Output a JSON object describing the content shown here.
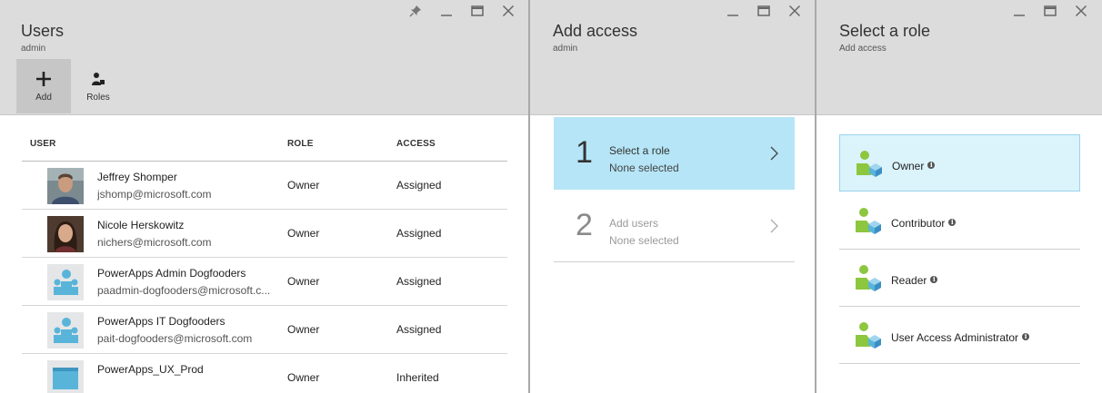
{
  "users_blade": {
    "title": "Users",
    "subtitle": "admin",
    "toolbar": {
      "add_label": "Add",
      "roles_label": "Roles"
    },
    "columns": {
      "user": "USER",
      "role": "ROLE",
      "access": "ACCESS"
    },
    "rows": [
      {
        "name": "Jeffrey Shomper",
        "email": "jshomp@microsoft.com",
        "role": "Owner",
        "access": "Assigned",
        "avatar": "photo-man"
      },
      {
        "name": "Nicole Herskowitz",
        "email": "nichers@microsoft.com",
        "role": "Owner",
        "access": "Assigned",
        "avatar": "photo-woman"
      },
      {
        "name": "PowerApps Admin Dogfooders",
        "email": "paadmin-dogfooders@microsoft.c...",
        "role": "Owner",
        "access": "Assigned",
        "avatar": "group-icon"
      },
      {
        "name": "PowerApps IT Dogfooders",
        "email": "pait-dogfooders@microsoft.com",
        "role": "Owner",
        "access": "Assigned",
        "avatar": "group-icon"
      },
      {
        "name": "PowerApps_UX_Prod",
        "email": "",
        "role": "Owner",
        "access": "Inherited",
        "avatar": "app-icon"
      }
    ]
  },
  "add_access_blade": {
    "title": "Add access",
    "subtitle": "admin",
    "steps": [
      {
        "number": "1",
        "title": "Select a role",
        "value": "None selected"
      },
      {
        "number": "2",
        "title": "Add users",
        "value": "None selected"
      }
    ]
  },
  "role_blade": {
    "title": "Select a role",
    "subtitle": "Add access",
    "roles": [
      {
        "label": "Owner",
        "selected": true
      },
      {
        "label": "Contributor",
        "selected": false
      },
      {
        "label": "Reader",
        "selected": false
      },
      {
        "label": "User Access Administrator",
        "selected": false
      }
    ]
  },
  "colors": {
    "selected_step": "#b5e5f6",
    "selected_role": "#dbf3fb",
    "header_bg": "#dcdcdc",
    "role_icon_green": "#8dc63f",
    "role_icon_blue": "#59b4d9"
  }
}
